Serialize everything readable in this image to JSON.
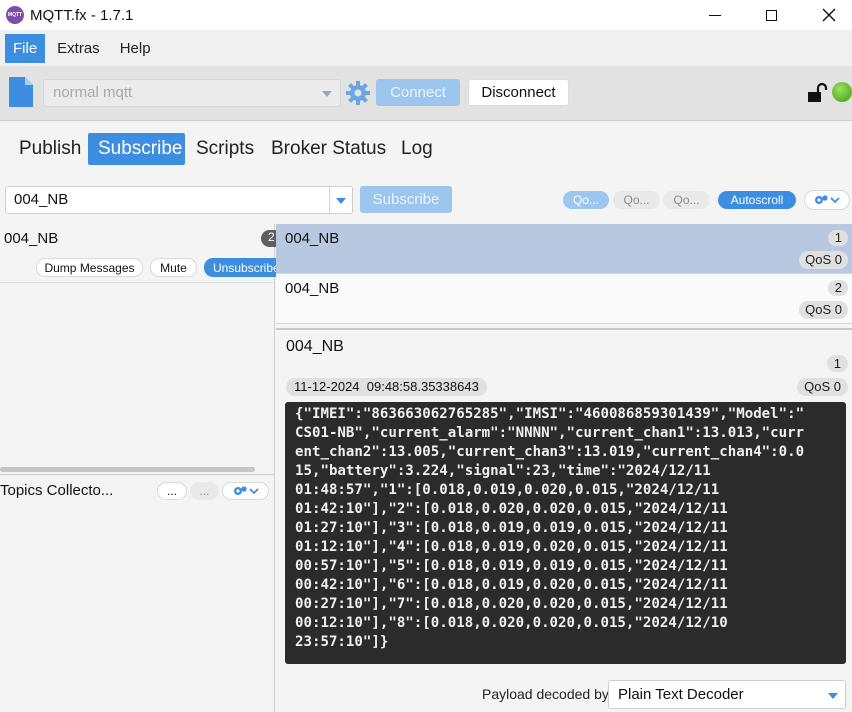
{
  "window": {
    "title": "MQTT.fx - 1.7.1",
    "icon_label": "MQTT"
  },
  "menu": [
    "File",
    "Extras",
    "Help"
  ],
  "toolbar": {
    "profile": "normal mqtt",
    "connect_label": "Connect",
    "disconnect_label": "Disconnect",
    "connection_status_color": "#4caf1e"
  },
  "tabs": [
    "Publish",
    "Subscribe",
    "Scripts",
    "Broker Status",
    "Log"
  ],
  "subscribe_bar": {
    "topic": "004_NB",
    "subscribe_label": "Subscribe",
    "qos_buttons": [
      "Qo...",
      "Qo...",
      "Qo..."
    ],
    "autoscroll_label": "Autoscroll"
  },
  "subscriptions": {
    "topic": "004_NB",
    "count": "2",
    "dump_label": "Dump Messages",
    "mute_label": "Mute",
    "unsubscribe_label": "Unsubscribe"
  },
  "topics_collector": {
    "title": "Topics Collecto...",
    "btn1": "...",
    "btn2": "..."
  },
  "messages": [
    {
      "topic": "004_NB",
      "num": "1",
      "qos": "QoS 0"
    },
    {
      "topic": "004_NB",
      "num": "2",
      "qos": "QoS 0"
    }
  ],
  "detail": {
    "topic": "004_NB",
    "num": "1",
    "timestamp": "11-12-2024  09:48:58.35338643",
    "qos": "QoS 0",
    "payload": "{\"IMEI\":\"863663062765285\",\"IMSI\":\"460086859301439\",\"Model\":\"\nCS01-NB\",\"current_alarm\":\"NNNN\",\"current_chan1\":13.013,\"curr\nent_chan2\":13.005,\"current_chan3\":13.019,\"current_chan4\":0.0\n15,\"battery\":3.224,\"signal\":23,\"time\":\"2024/12/11\n01:48:57\",\"1\":[0.018,0.019,0.020,0.015,\"2024/12/11\n01:42:10\"],\"2\":[0.018,0.020,0.020,0.015,\"2024/12/11\n01:27:10\"],\"3\":[0.018,0.019,0.019,0.015,\"2024/12/11\n01:12:10\"],\"4\":[0.018,0.019,0.020,0.015,\"2024/12/11\n00:57:10\"],\"5\":[0.018,0.019,0.019,0.015,\"2024/12/11\n00:42:10\"],\"6\":[0.018,0.019,0.020,0.015,\"2024/12/11\n00:27:10\"],\"7\":[0.018,0.020,0.020,0.015,\"2024/12/11\n00:12:10\"],\"8\":[0.018,0.020,0.020,0.015,\"2024/12/10\n23:57:10\"]}",
    "decoder_label": "Payload decoded by",
    "decoder": "Plain Text Decoder"
  }
}
